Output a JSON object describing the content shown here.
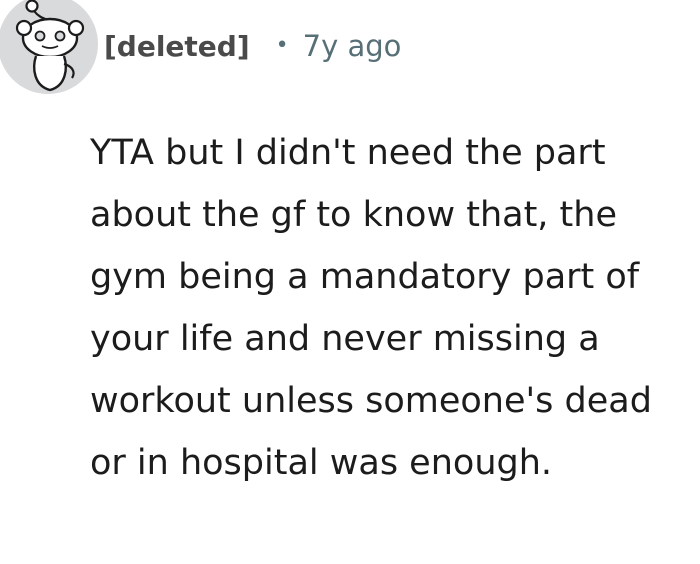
{
  "comment": {
    "author": "[deleted]",
    "separator": "•",
    "time": "7y ago",
    "avatar_icon": "reddit-snoo-deleted-icon",
    "body": "YTA but I didn't need the part about the gf to know that, the gym being a mandatory part of your life and never missing a workout unless someone's dead or in hospital was enough."
  },
  "colors": {
    "background": "#ffffff",
    "text": "#1c1c1c",
    "meta": "#576f76",
    "avatar_bg": "#d9dadc"
  }
}
